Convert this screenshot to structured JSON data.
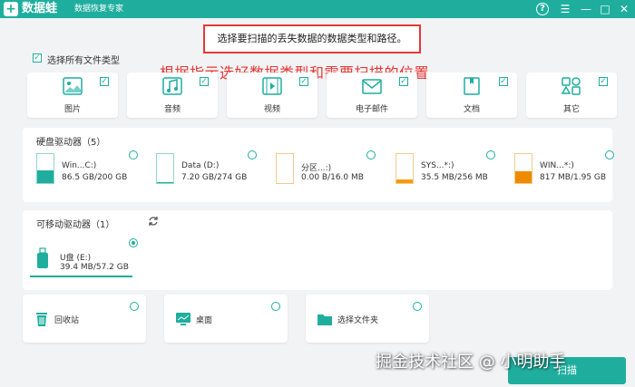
{
  "app": {
    "logo": "+",
    "name": "数据蛙",
    "subtitle": "数据恢复专家"
  },
  "window": {
    "help": "?",
    "menu": "☰",
    "minimize": "—",
    "maximize": "□",
    "close": "✕"
  },
  "notice": "选择要扫描的丢失数据的数据类型和路径。",
  "hint": "根据指示选好数据类型和需要扫描的位置",
  "select_all": {
    "label": "选择所有文件类型",
    "checked": true
  },
  "file_types": [
    {
      "label": "图片",
      "icon": "image-icon",
      "checked": true
    },
    {
      "label": "音频",
      "icon": "audio-icon",
      "checked": true
    },
    {
      "label": "视频",
      "icon": "video-icon",
      "checked": true
    },
    {
      "label": "电子邮件",
      "icon": "email-icon",
      "checked": true
    },
    {
      "label": "文档",
      "icon": "document-icon",
      "checked": true
    },
    {
      "label": "其它",
      "icon": "other-icon",
      "checked": true
    }
  ],
  "hard_drives": {
    "title": "硬盘驱动器（5）",
    "items": [
      {
        "name": "Win...C:)",
        "size": "86.5 GB/200 GB",
        "used": 0.43,
        "color": "#1fae9e"
      },
      {
        "name": "Data (D:)",
        "size": "7.20 GB/274 GB",
        "used": 0.03,
        "color": "#1fae9e"
      },
      {
        "name": "分区...:)",
        "size": "0.00  B/16.0 MB",
        "used": 0.0,
        "color": "#f39c12"
      },
      {
        "name": "SYS...*:)",
        "size": "35.5 MB/256 MB",
        "used": 0.14,
        "color": "#f39c12"
      },
      {
        "name": "WIN...*:)",
        "size": "817 MB/1.95 GB",
        "used": 0.42,
        "color": "#f08a00"
      }
    ]
  },
  "removable": {
    "title": "可移动驱动器（1）",
    "items": [
      {
        "name": "U盘 (E:)",
        "size": "39.4 MB/57.2 GB",
        "selected": true
      }
    ]
  },
  "locations": [
    {
      "label": "回收站",
      "icon": "recycle-bin-icon"
    },
    {
      "label": "桌面",
      "icon": "desktop-icon"
    },
    {
      "label": "选择文件夹",
      "icon": "folder-icon"
    }
  ],
  "scan_button": "扫描",
  "watermark": "掘金技术社区 @ 小明助手"
}
